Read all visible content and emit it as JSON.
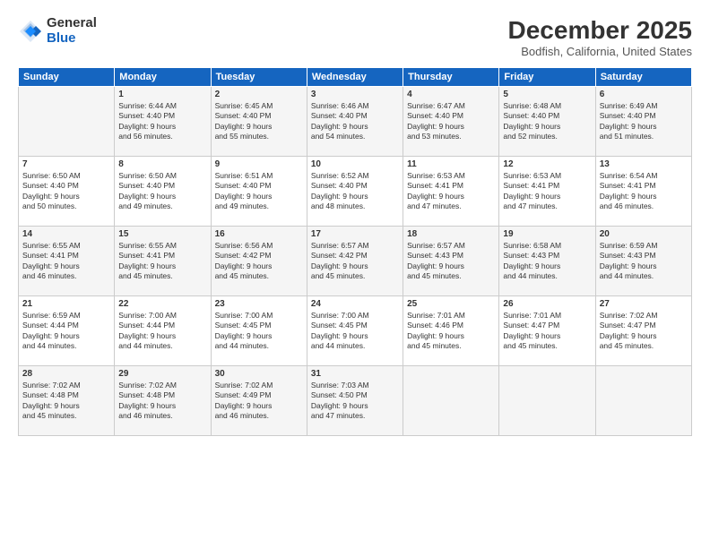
{
  "header": {
    "logo_general": "General",
    "logo_blue": "Blue",
    "month_title": "December 2025",
    "location": "Bodfish, California, United States"
  },
  "days_of_week": [
    "Sunday",
    "Monday",
    "Tuesday",
    "Wednesday",
    "Thursday",
    "Friday",
    "Saturday"
  ],
  "weeks": [
    [
      {
        "day": "",
        "lines": []
      },
      {
        "day": "1",
        "lines": [
          "Sunrise: 6:44 AM",
          "Sunset: 4:40 PM",
          "Daylight: 9 hours",
          "and 56 minutes."
        ]
      },
      {
        "day": "2",
        "lines": [
          "Sunrise: 6:45 AM",
          "Sunset: 4:40 PM",
          "Daylight: 9 hours",
          "and 55 minutes."
        ]
      },
      {
        "day": "3",
        "lines": [
          "Sunrise: 6:46 AM",
          "Sunset: 4:40 PM",
          "Daylight: 9 hours",
          "and 54 minutes."
        ]
      },
      {
        "day": "4",
        "lines": [
          "Sunrise: 6:47 AM",
          "Sunset: 4:40 PM",
          "Daylight: 9 hours",
          "and 53 minutes."
        ]
      },
      {
        "day": "5",
        "lines": [
          "Sunrise: 6:48 AM",
          "Sunset: 4:40 PM",
          "Daylight: 9 hours",
          "and 52 minutes."
        ]
      },
      {
        "day": "6",
        "lines": [
          "Sunrise: 6:49 AM",
          "Sunset: 4:40 PM",
          "Daylight: 9 hours",
          "and 51 minutes."
        ]
      }
    ],
    [
      {
        "day": "7",
        "lines": [
          "Sunrise: 6:50 AM",
          "Sunset: 4:40 PM",
          "Daylight: 9 hours",
          "and 50 minutes."
        ]
      },
      {
        "day": "8",
        "lines": [
          "Sunrise: 6:50 AM",
          "Sunset: 4:40 PM",
          "Daylight: 9 hours",
          "and 49 minutes."
        ]
      },
      {
        "day": "9",
        "lines": [
          "Sunrise: 6:51 AM",
          "Sunset: 4:40 PM",
          "Daylight: 9 hours",
          "and 49 minutes."
        ]
      },
      {
        "day": "10",
        "lines": [
          "Sunrise: 6:52 AM",
          "Sunset: 4:40 PM",
          "Daylight: 9 hours",
          "and 48 minutes."
        ]
      },
      {
        "day": "11",
        "lines": [
          "Sunrise: 6:53 AM",
          "Sunset: 4:41 PM",
          "Daylight: 9 hours",
          "and 47 minutes."
        ]
      },
      {
        "day": "12",
        "lines": [
          "Sunrise: 6:53 AM",
          "Sunset: 4:41 PM",
          "Daylight: 9 hours",
          "and 47 minutes."
        ]
      },
      {
        "day": "13",
        "lines": [
          "Sunrise: 6:54 AM",
          "Sunset: 4:41 PM",
          "Daylight: 9 hours",
          "and 46 minutes."
        ]
      }
    ],
    [
      {
        "day": "14",
        "lines": [
          "Sunrise: 6:55 AM",
          "Sunset: 4:41 PM",
          "Daylight: 9 hours",
          "and 46 minutes."
        ]
      },
      {
        "day": "15",
        "lines": [
          "Sunrise: 6:55 AM",
          "Sunset: 4:41 PM",
          "Daylight: 9 hours",
          "and 45 minutes."
        ]
      },
      {
        "day": "16",
        "lines": [
          "Sunrise: 6:56 AM",
          "Sunset: 4:42 PM",
          "Daylight: 9 hours",
          "and 45 minutes."
        ]
      },
      {
        "day": "17",
        "lines": [
          "Sunrise: 6:57 AM",
          "Sunset: 4:42 PM",
          "Daylight: 9 hours",
          "and 45 minutes."
        ]
      },
      {
        "day": "18",
        "lines": [
          "Sunrise: 6:57 AM",
          "Sunset: 4:43 PM",
          "Daylight: 9 hours",
          "and 45 minutes."
        ]
      },
      {
        "day": "19",
        "lines": [
          "Sunrise: 6:58 AM",
          "Sunset: 4:43 PM",
          "Daylight: 9 hours",
          "and 44 minutes."
        ]
      },
      {
        "day": "20",
        "lines": [
          "Sunrise: 6:59 AM",
          "Sunset: 4:43 PM",
          "Daylight: 9 hours",
          "and 44 minutes."
        ]
      }
    ],
    [
      {
        "day": "21",
        "lines": [
          "Sunrise: 6:59 AM",
          "Sunset: 4:44 PM",
          "Daylight: 9 hours",
          "and 44 minutes."
        ]
      },
      {
        "day": "22",
        "lines": [
          "Sunrise: 7:00 AM",
          "Sunset: 4:44 PM",
          "Daylight: 9 hours",
          "and 44 minutes."
        ]
      },
      {
        "day": "23",
        "lines": [
          "Sunrise: 7:00 AM",
          "Sunset: 4:45 PM",
          "Daylight: 9 hours",
          "and 44 minutes."
        ]
      },
      {
        "day": "24",
        "lines": [
          "Sunrise: 7:00 AM",
          "Sunset: 4:45 PM",
          "Daylight: 9 hours",
          "and 44 minutes."
        ]
      },
      {
        "day": "25",
        "lines": [
          "Sunrise: 7:01 AM",
          "Sunset: 4:46 PM",
          "Daylight: 9 hours",
          "and 45 minutes."
        ]
      },
      {
        "day": "26",
        "lines": [
          "Sunrise: 7:01 AM",
          "Sunset: 4:47 PM",
          "Daylight: 9 hours",
          "and 45 minutes."
        ]
      },
      {
        "day": "27",
        "lines": [
          "Sunrise: 7:02 AM",
          "Sunset: 4:47 PM",
          "Daylight: 9 hours",
          "and 45 minutes."
        ]
      }
    ],
    [
      {
        "day": "28",
        "lines": [
          "Sunrise: 7:02 AM",
          "Sunset: 4:48 PM",
          "Daylight: 9 hours",
          "and 45 minutes."
        ]
      },
      {
        "day": "29",
        "lines": [
          "Sunrise: 7:02 AM",
          "Sunset: 4:48 PM",
          "Daylight: 9 hours",
          "and 46 minutes."
        ]
      },
      {
        "day": "30",
        "lines": [
          "Sunrise: 7:02 AM",
          "Sunset: 4:49 PM",
          "Daylight: 9 hours",
          "and 46 minutes."
        ]
      },
      {
        "day": "31",
        "lines": [
          "Sunrise: 7:03 AM",
          "Sunset: 4:50 PM",
          "Daylight: 9 hours",
          "and 47 minutes."
        ]
      },
      {
        "day": "",
        "lines": []
      },
      {
        "day": "",
        "lines": []
      },
      {
        "day": "",
        "lines": []
      }
    ]
  ]
}
